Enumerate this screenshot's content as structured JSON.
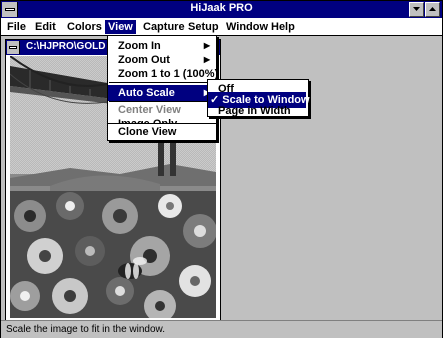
{
  "app": {
    "title": "HiJaak PRO"
  },
  "menubar": {
    "items": [
      "File",
      "Edit",
      "Colors",
      "View",
      "Capture",
      "Setup",
      "Window",
      "Help"
    ],
    "active": "View"
  },
  "document": {
    "title": "C:\\HJPRO\\GOLD"
  },
  "view_menu": {
    "items": [
      {
        "label": "Zoom In",
        "submenu": true,
        "state": "normal"
      },
      {
        "label": "Zoom Out",
        "submenu": true,
        "state": "normal"
      },
      {
        "label": "Zoom 1 to 1 (100%)",
        "submenu": false,
        "state": "normal"
      },
      {
        "label": "Auto Scale",
        "submenu": true,
        "state": "highlighted"
      },
      {
        "label": "Center View",
        "submenu": false,
        "state": "disabled"
      },
      {
        "label": "Image Only",
        "submenu": false,
        "state": "normal"
      },
      {
        "label": "Clone View",
        "submenu": false,
        "state": "normal"
      }
    ]
  },
  "auto_scale_menu": {
    "items": [
      {
        "label": "Off",
        "checked": false,
        "state": "normal"
      },
      {
        "label": "Scale to Window",
        "checked": true,
        "state": "highlighted"
      },
      {
        "label": "Page in Width",
        "checked": false,
        "state": "normal"
      }
    ]
  },
  "status": {
    "text": "Scale the image to fit in the window."
  },
  "colors": {
    "titlebar": "#000080",
    "face": "#c0c0c0",
    "highlight": "#000080"
  }
}
